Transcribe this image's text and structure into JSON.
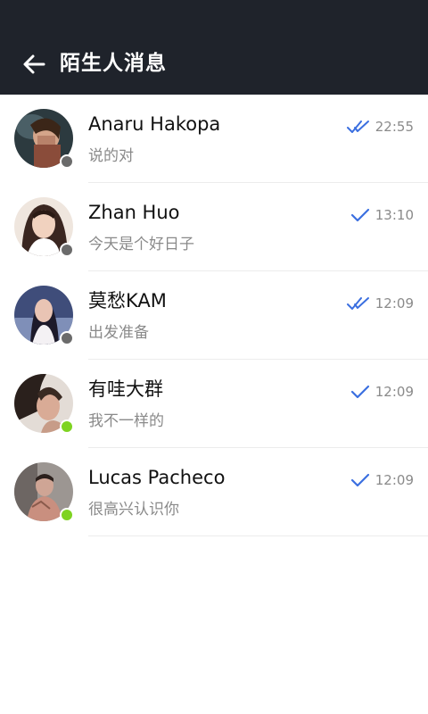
{
  "header": {
    "title": "陌生人消息",
    "back_icon": "arrow-left-icon",
    "background": "#1f232b"
  },
  "colors": {
    "online": "#7ed321",
    "offline": "#6b6b6b",
    "check": "#3b6fe0"
  },
  "conversations": [
    {
      "name": "Anaru Hakopa",
      "preview": "说的对",
      "time": "22:55",
      "status": "offline",
      "receipt": "double-check-icon"
    },
    {
      "name": "Zhan Huo",
      "preview": "今天是个好日子",
      "time": "13:10",
      "status": "offline",
      "receipt": "check-icon"
    },
    {
      "name": "莫愁KAM",
      "preview": "出发准备",
      "time": "12:09",
      "status": "offline",
      "receipt": "double-check-icon"
    },
    {
      "name": "有哇大群",
      "preview": "我不一样的",
      "time": "12:09",
      "status": "online",
      "receipt": "check-icon"
    },
    {
      "name": "Lucas Pacheco",
      "preview": "很高兴认识你",
      "time": "12:09",
      "status": "online",
      "receipt": "check-icon"
    }
  ]
}
